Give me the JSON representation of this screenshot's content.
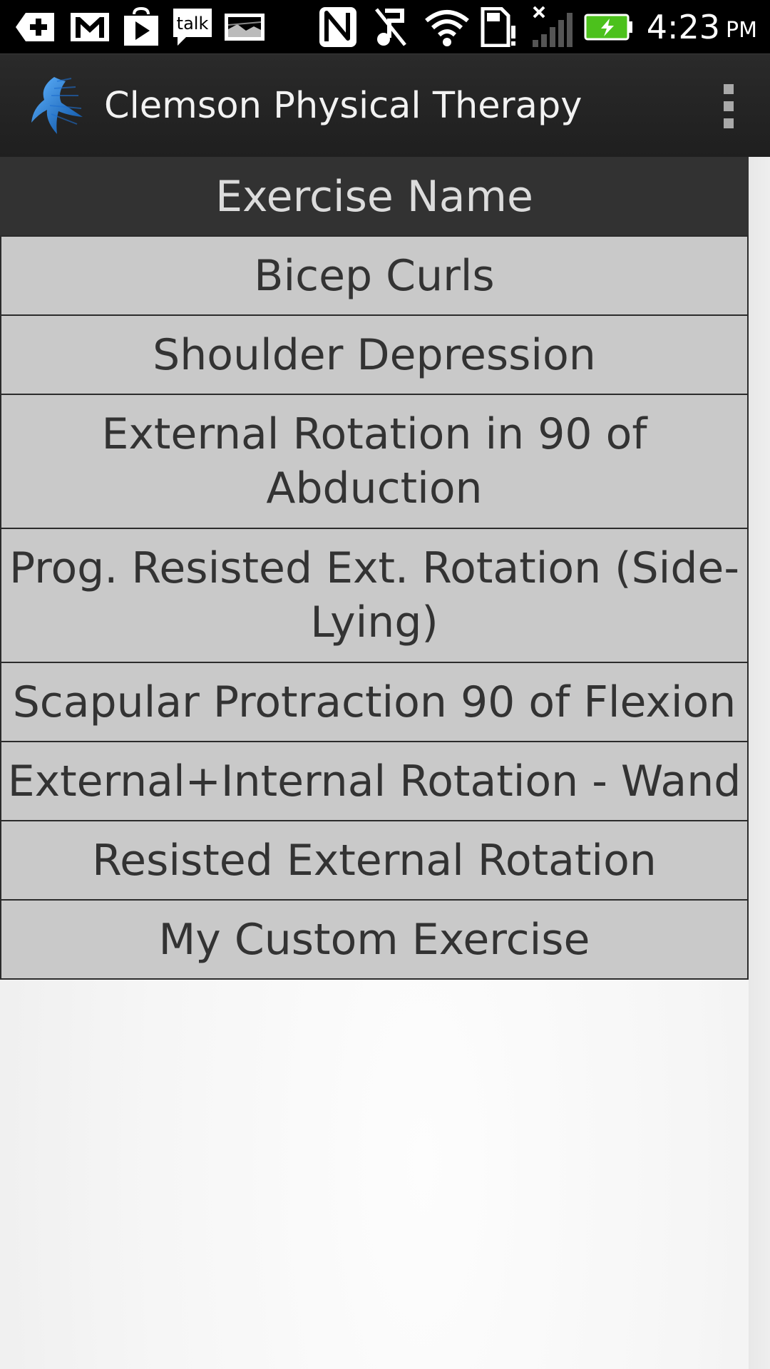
{
  "status_bar": {
    "time": "4:23",
    "ampm": "PM",
    "talk_label": "talk",
    "icons": [
      "add-icon",
      "gmail-icon",
      "play-store-icon",
      "talk-icon",
      "picture-icon",
      "nfc-icon",
      "music-muted-icon",
      "wifi-icon",
      "sd-card-alert-icon",
      "signal-no-service-icon",
      "battery-charging-icon"
    ]
  },
  "action_bar": {
    "title": "Clemson Physical Therapy",
    "logo": "runner-logo-icon",
    "menu_icon": "overflow-menu-icon"
  },
  "table": {
    "header": "Exercise Name",
    "rows": [
      "Bicep Curls",
      "Shoulder Depression",
      "External Rotation in 90 of Abduction",
      "Prog. Resisted Ext. Rotation (Side-Lying)",
      "Scapular Protraction 90 of Flexion",
      "External+Internal Rotation - Wand",
      "Resisted External Rotation",
      "My Custom Exercise"
    ]
  },
  "colors": {
    "status_bar_bg": "#000000",
    "action_bar_bg": "#222222",
    "table_header_bg": "#323232",
    "row_bg": "#c9c9c9",
    "row_border": "#2b2b2b",
    "battery_green": "#4cc11c"
  }
}
